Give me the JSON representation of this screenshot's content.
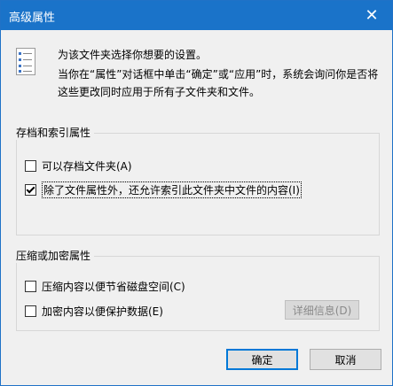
{
  "window": {
    "title": "高级属性",
    "close_glyph": "✕"
  },
  "header": {
    "icon": "properties-list-icon",
    "line1": "为该文件夹选择你想要的设置。",
    "line2": "当你在“属性”对话框中单击“确定”或“应用”时，系统会询问你是否将这些更改同时应用于所有子文件夹和文件。"
  },
  "archive_group": {
    "title": "存档和索引属性",
    "archive_label": "可以存档文件夹(A)",
    "archive_checked": false,
    "index_label": "除了文件属性外，还允许索引此文件夹中文件的内容(I)",
    "index_checked": true
  },
  "compress_group": {
    "title": "压缩或加密属性",
    "compress_label": "压缩内容以便节省磁盘空间(C)",
    "compress_checked": false,
    "encrypt_label": "加密内容以便保护数据(E)",
    "encrypt_checked": false,
    "details_label": "详细信息(D)"
  },
  "buttons": {
    "ok": "确定",
    "cancel": "取消"
  }
}
